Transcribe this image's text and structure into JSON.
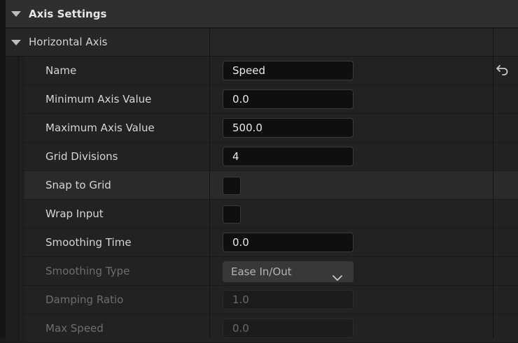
{
  "section": {
    "title": "Axis Settings"
  },
  "group": {
    "title": "Horizontal Axis"
  },
  "properties": [
    {
      "label": "Name",
      "value": "Speed"
    },
    {
      "label": "Minimum Axis Value",
      "value": "0.0"
    },
    {
      "label": "Maximum Axis Value",
      "value": "500.0"
    },
    {
      "label": "Grid Divisions",
      "value": "4"
    },
    {
      "label": "Snap to Grid",
      "checked": false
    },
    {
      "label": "Wrap Input",
      "checked": false
    },
    {
      "label": "Smoothing Time",
      "value": "0.0"
    },
    {
      "label": "Smoothing Type",
      "value": "Ease In/Out",
      "disabled": true
    },
    {
      "label": "Damping Ratio",
      "value": "1.0",
      "disabled": true
    },
    {
      "label": "Max Speed",
      "value": "0.0",
      "disabled": true
    }
  ],
  "icons": {
    "section_toggle": "triangle-down-icon",
    "group_toggle": "triangle-down-icon",
    "reset": "reset-arrow-icon",
    "dropdown": "chevron-down-icon"
  }
}
